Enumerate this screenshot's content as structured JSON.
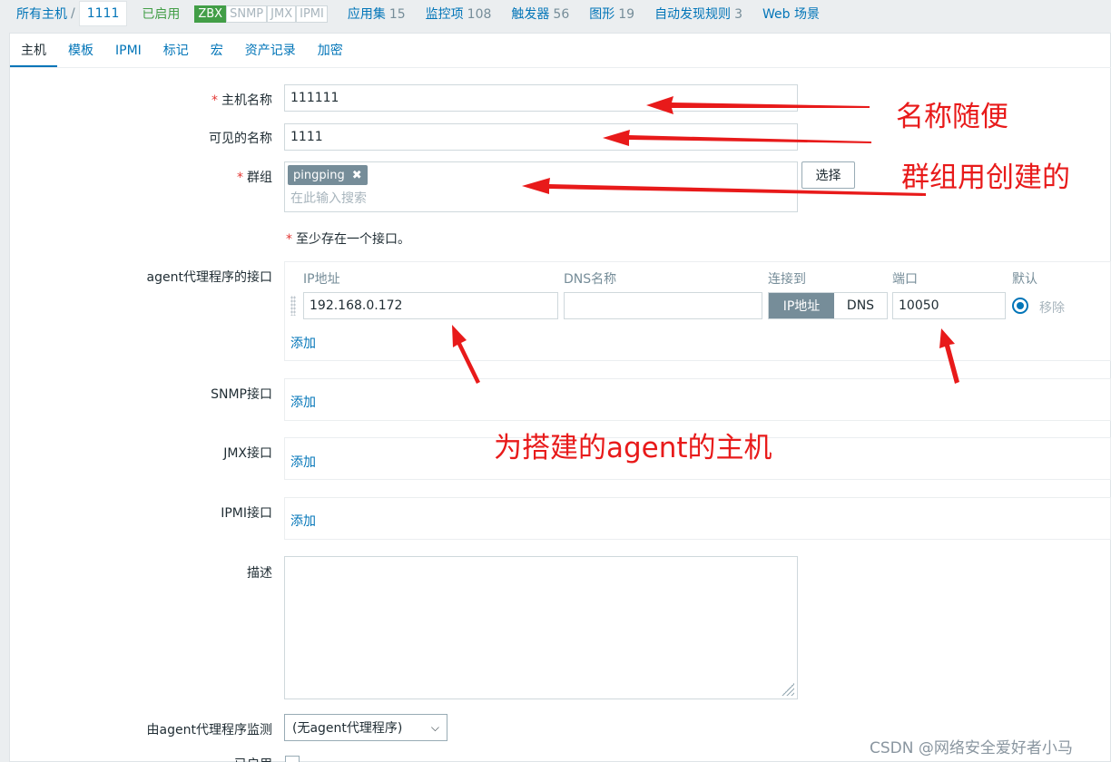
{
  "breadcrumb": {
    "all_hosts": "所有主机",
    "separator": "/",
    "current": "1111",
    "status": "已启用",
    "badges": [
      "ZBX",
      "SNMP",
      "JMX",
      "IPMI"
    ],
    "links": [
      {
        "label": "应用集",
        "count": "15"
      },
      {
        "label": "监控项",
        "count": "108"
      },
      {
        "label": "触发器",
        "count": "56"
      },
      {
        "label": "图形",
        "count": "19"
      },
      {
        "label": "自动发现规则",
        "count": "3"
      },
      {
        "label": "Web 场景",
        "count": ""
      }
    ]
  },
  "tabs": [
    "主机",
    "模板",
    "IPMI",
    "标记",
    "宏",
    "资产记录",
    "加密"
  ],
  "form": {
    "host_name_label": "主机名称",
    "host_name_value": "111111",
    "visible_name_label": "可见的名称",
    "visible_name_value": "1111",
    "groups_label": "群组",
    "group_chip": "pingping",
    "group_placeholder": "在此输入搜索",
    "select_button": "选择",
    "interface_note": "至少存在一个接口。",
    "agent_label": "agent代理程序的接口",
    "columns": {
      "ip": "IP地址",
      "dns": "DNS名称",
      "connect": "连接到",
      "port": "端口",
      "default": "默认"
    },
    "agent_ip": "192.168.0.172",
    "agent_dns": "",
    "connect_ip": "IP地址",
    "connect_dns": "DNS",
    "agent_port": "10050",
    "remove": "移除",
    "add": "添加",
    "snmp_label": "SNMP接口",
    "jmx_label": "JMX接口",
    "ipmi_label": "IPMI接口",
    "description_label": "描述",
    "proxy_label": "由agent代理程序监测",
    "proxy_value": "(无agent代理程序)",
    "enabled_label": "已启用"
  },
  "annotations": {
    "name": "名称随便",
    "group": "群组用创建的",
    "agent": "为搭建的agent的主机"
  },
  "watermark": "CSDN @网络安全爱好者小马",
  "colors": {
    "annotation": "#e81a1a",
    "link": "#0275b8",
    "enabled": "#429e47"
  }
}
